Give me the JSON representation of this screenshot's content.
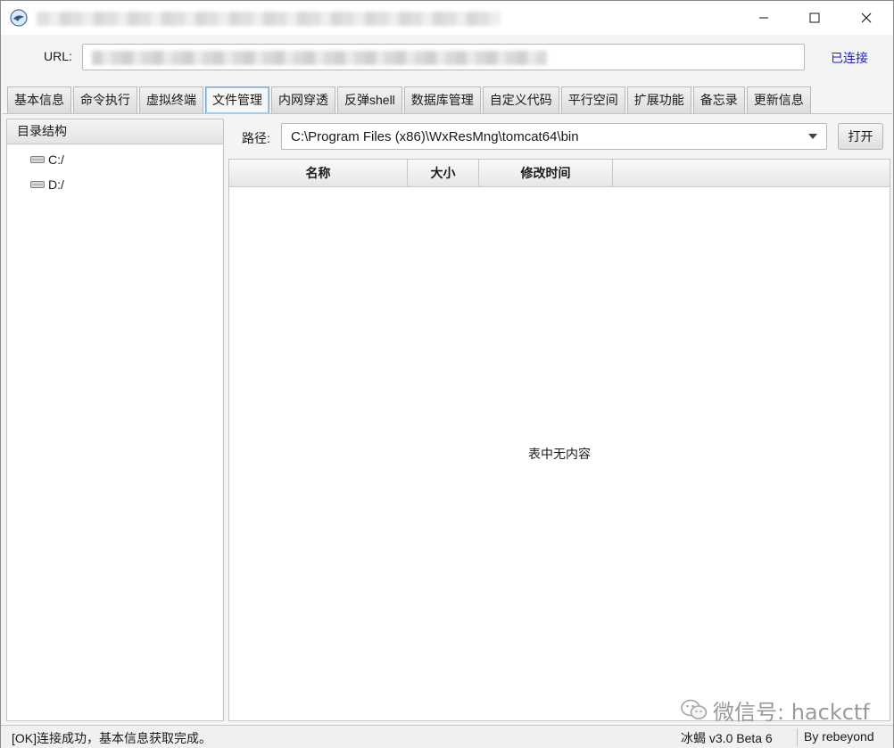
{
  "url_row": {
    "label": "URL:",
    "value": "",
    "status": "已连接"
  },
  "tabs": [
    {
      "label": "基本信息"
    },
    {
      "label": "命令执行"
    },
    {
      "label": "虚拟终端"
    },
    {
      "label": "文件管理",
      "active": true
    },
    {
      "label": "内网穿透"
    },
    {
      "label": "反弹shell"
    },
    {
      "label": "数据库管理"
    },
    {
      "label": "自定义代码"
    },
    {
      "label": "平行空间"
    },
    {
      "label": "扩展功能"
    },
    {
      "label": "备忘录"
    },
    {
      "label": "更新信息"
    }
  ],
  "tree": {
    "header": "目录结构",
    "items": [
      {
        "label": "C:/",
        "icon": "drive-icon"
      },
      {
        "label": "D:/",
        "icon": "drive-icon"
      }
    ]
  },
  "path": {
    "label": "路径:",
    "value": "C:\\Program Files (x86)\\WxResMng\\tomcat64\\bin",
    "open_button": "打开"
  },
  "table": {
    "columns": [
      "名称",
      "大小",
      "修改时间"
    ],
    "rows": [],
    "empty_message": "表中无内容"
  },
  "watermark": "微信号: hackctf",
  "statusbar": {
    "message": "[OK]连接成功，基本信息获取完成。",
    "version": "冰蝎 v3.0 Beta 6",
    "author": "By rebeyond"
  },
  "colors": {
    "status_link": "#1b1bd6",
    "active_tab_border": "#6ea9d8"
  }
}
